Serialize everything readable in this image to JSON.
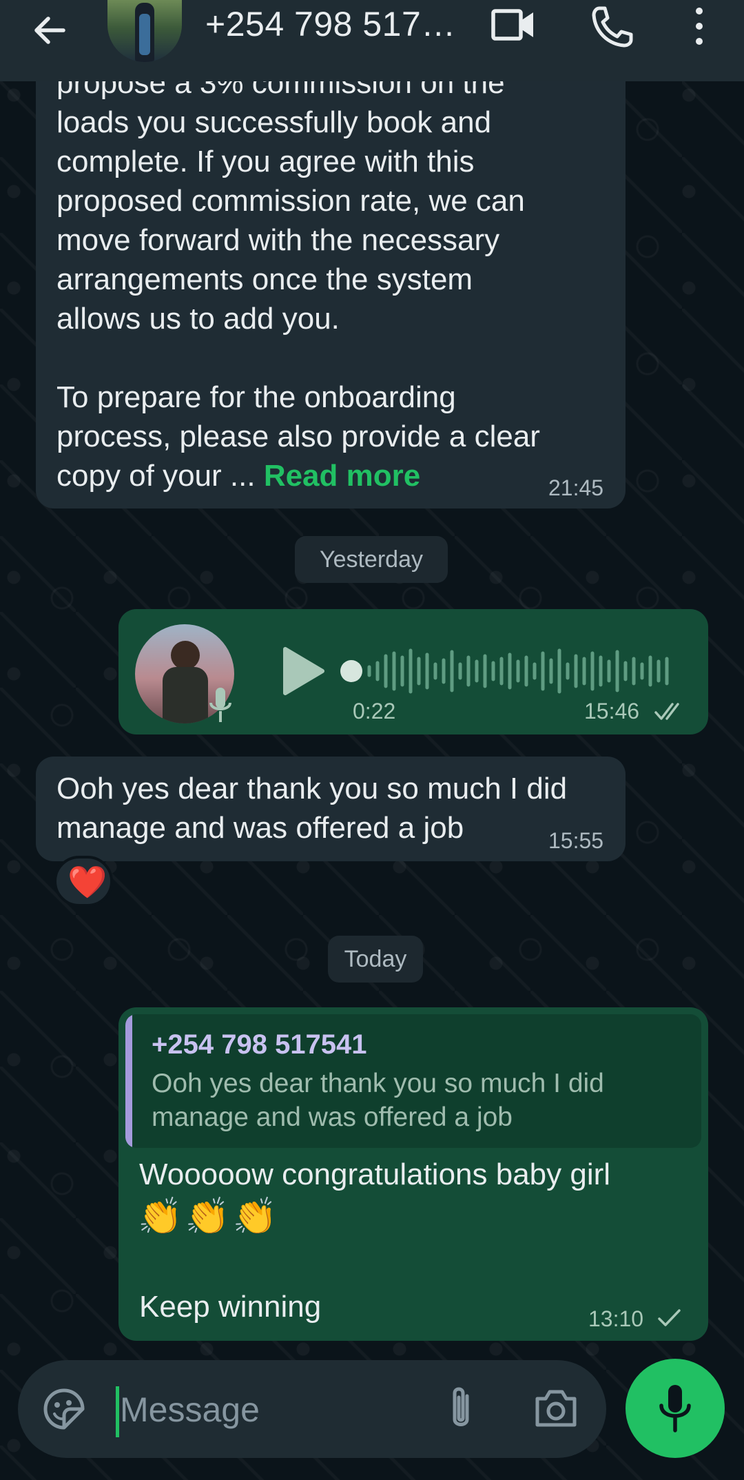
{
  "header": {
    "contact_name": "+254 798 517…"
  },
  "messages": {
    "first": {
      "lines": [
        "propose a 3% commission on the",
        "loads you successfully book and",
        "complete. If you agree with this",
        "proposed commission rate, we can",
        "move forward with the necessary",
        "arrangements once the system",
        "allows us to add you.",
        "",
        "To prepare for the onboarding",
        "process, please also provide a clear"
      ],
      "last_line": "copy of your ...",
      "read_more": "Read more",
      "time": "21:45"
    },
    "date_yesterday": "Yesterday",
    "voice_note": {
      "duration": "0:22",
      "time": "15:46",
      "status": "read"
    },
    "reply_in": {
      "text": "Ooh yes dear thank you so much I did manage and was offered a job",
      "time": "15:55",
      "reaction": "❤️"
    },
    "date_today": "Today",
    "reply_out": {
      "quote_name": "+254 798 517541",
      "quote_text": "Ooh yes dear thank you so much I did manage and was offered a job",
      "line1": "Wooooow congratulations baby girl",
      "emojis": "👏👏👏",
      "line2": "Keep winning",
      "time": "13:10",
      "status": "sent"
    }
  },
  "composer": {
    "placeholder": "Message"
  },
  "colors": {
    "accent": "#21c063",
    "outgoing_bubble": "#144d37",
    "incoming_bubble": "#1f2c34",
    "background": "#0b141a"
  }
}
